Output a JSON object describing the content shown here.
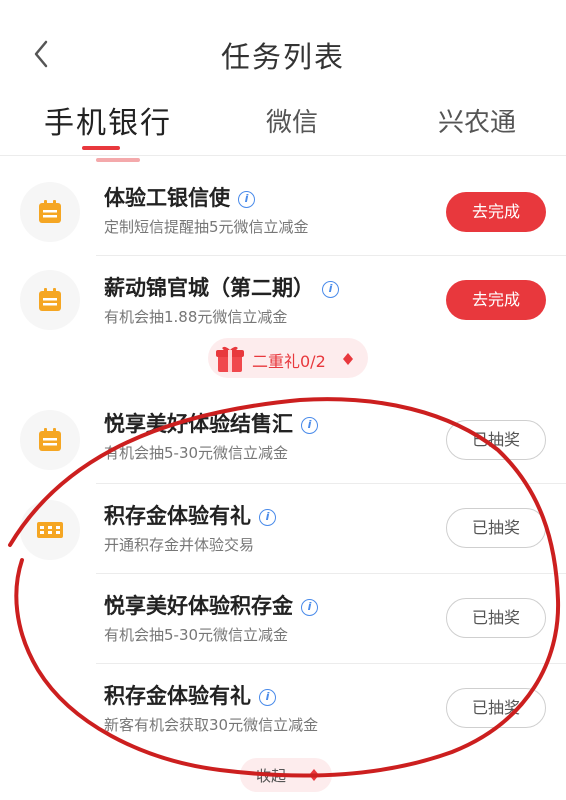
{
  "header": {
    "title": "任务列表"
  },
  "tabs": [
    {
      "label": "手机银行"
    },
    {
      "label": "微信"
    },
    {
      "label": "兴农通"
    }
  ],
  "tasks": [
    {
      "title": "体验工银信使",
      "subtitle": "定制短信提醒抽5元微信立减金",
      "action": "去完成",
      "icon": "calendar-icon"
    },
    {
      "title": "薪动锦官城（第二期）",
      "subtitle": "有机会抽1.88元微信立减金",
      "action": "去完成",
      "icon": "calendar-icon"
    },
    {
      "title": "悦享美好体验结售汇",
      "subtitle": "有机会抽5-30元微信立减金",
      "action": "已抽奖",
      "icon": "calendar-icon"
    },
    {
      "title": "积存金体验有礼",
      "subtitle": "开通积存金并体验交易",
      "action": "已抽奖",
      "icon": "gold-bar-icon"
    },
    {
      "title": "悦享美好体验积存金",
      "subtitle": "有机会抽5-30元微信立减金",
      "action": "已抽奖",
      "icon": ""
    },
    {
      "title": "积存金体验有礼",
      "subtitle": "新客有机会获取30元微信立减金",
      "action": "已抽奖",
      "icon": ""
    }
  ],
  "gift": {
    "label": "二重礼0/2"
  },
  "collapse": {
    "label": "收起"
  },
  "colors": {
    "accent": "#e8383d",
    "icon_orange": "#f5a623",
    "info_blue": "#4a8bea",
    "annotation": "#cc1f1f"
  }
}
